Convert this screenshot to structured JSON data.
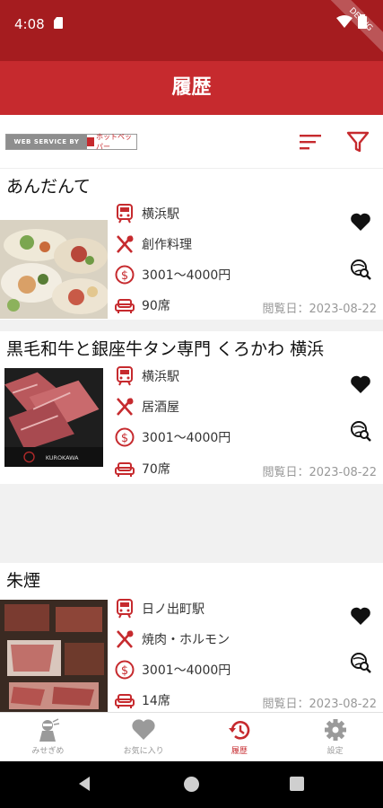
{
  "status_bar": {
    "time": "4:08",
    "debug_label": "DEBUG"
  },
  "app_bar": {
    "title": "履歴"
  },
  "toolbar": {
    "credit_left": "WEB SERVICE BY",
    "credit_right": "ホットペッパー"
  },
  "colors": {
    "brand_red": "#c62a2e",
    "status_red": "#a51c1f",
    "muted_gray": "#999999"
  },
  "restaurants": [
    {
      "name": "あんだんて",
      "station": "横浜駅",
      "genre": "創作料理",
      "budget": "3001～4000円",
      "seats": "90席",
      "visited": "閲覧日：2023-08-22"
    },
    {
      "name": "黒毛和牛と銀座牛タン専門 くろかわ 横浜",
      "station": "横浜駅",
      "genre": "居酒屋",
      "budget": "3001～4000円",
      "seats": "70席",
      "visited": "閲覧日：2023-08-22",
      "photo_caption": "KUROKAWA"
    },
    {
      "name": "朱煙",
      "station": "日ノ出町駅",
      "genre": "焼肉・ホルモン",
      "budget": "3001～4000円",
      "seats": "14席",
      "visited": "閲覧日：2023-08-22"
    }
  ],
  "bottom_nav": [
    {
      "label": "みせぎめ",
      "icon": "ninja-icon"
    },
    {
      "label": "お気に入り",
      "icon": "heart-icon"
    },
    {
      "label": "履歴",
      "icon": "history-icon",
      "active": true
    },
    {
      "label": "設定",
      "icon": "gear-icon"
    }
  ]
}
